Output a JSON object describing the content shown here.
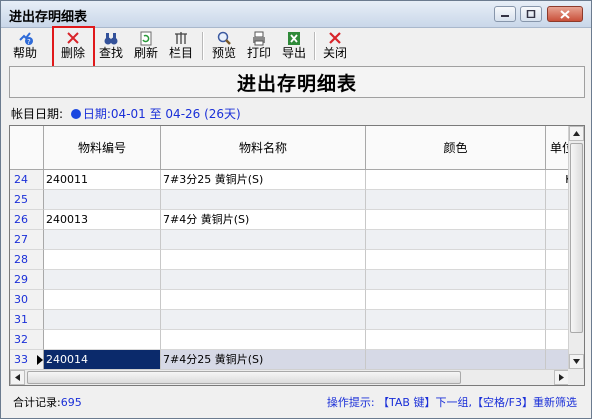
{
  "window": {
    "title": "进出存明细表"
  },
  "toolbar": {
    "items": [
      {
        "label": "帮助",
        "icon": "help-icon"
      },
      {
        "label": "删除",
        "icon": "delete-x-icon"
      },
      {
        "label": "查找",
        "icon": "binoculars-icon"
      },
      {
        "label": "刷新",
        "icon": "refresh-icon"
      },
      {
        "label": "栏目",
        "icon": "columns-icon"
      },
      {
        "label": "预览",
        "icon": "magnifier-icon"
      },
      {
        "label": "打印",
        "icon": "printer-icon"
      },
      {
        "label": "导出",
        "icon": "excel-export-icon"
      },
      {
        "label": "关闭",
        "icon": "close-x-icon"
      }
    ]
  },
  "report": {
    "heading": "进出存明细表",
    "period_label": "帐目日期:",
    "period_prefix": "日期:",
    "period_value": "04-01 至 04-26 (26天)"
  },
  "grid": {
    "columns": [
      "物料编号",
      "物料名称",
      "颜色",
      "单位"
    ],
    "rows": [
      {
        "num": "24",
        "code": "240011",
        "name": "7#3分25 黄铜片(S)",
        "color": "",
        "unit": "KG"
      },
      {
        "num": "25",
        "code": "",
        "name": "",
        "color": "",
        "unit": ""
      },
      {
        "num": "26",
        "code": "240013",
        "name": "7#4分 黄铜片(S)",
        "color": "",
        "unit": ""
      },
      {
        "num": "27",
        "code": "",
        "name": "",
        "color": "",
        "unit": ""
      },
      {
        "num": "28",
        "code": "",
        "name": "",
        "color": "",
        "unit": ""
      },
      {
        "num": "29",
        "code": "",
        "name": "",
        "color": "",
        "unit": ""
      },
      {
        "num": "30",
        "code": "",
        "name": "",
        "color": "",
        "unit": ""
      },
      {
        "num": "31",
        "code": "",
        "name": "",
        "color": "",
        "unit": ""
      },
      {
        "num": "32",
        "code": "",
        "name": "",
        "color": "",
        "unit": ""
      },
      {
        "num": "33",
        "code": "240014",
        "name": "7#4分25 黄铜片(S)",
        "color": "",
        "unit": ""
      }
    ],
    "selected_row_num": "33"
  },
  "status": {
    "record_label": "合计记录:",
    "record_count": "695",
    "hint": "操作提示: 【TAB 键】下一组,【空格/F3】重新筛选"
  },
  "colors": {
    "accent": "#1a2fd8",
    "selection": "#0b2a6b",
    "highlight_box": "#e0191b"
  }
}
